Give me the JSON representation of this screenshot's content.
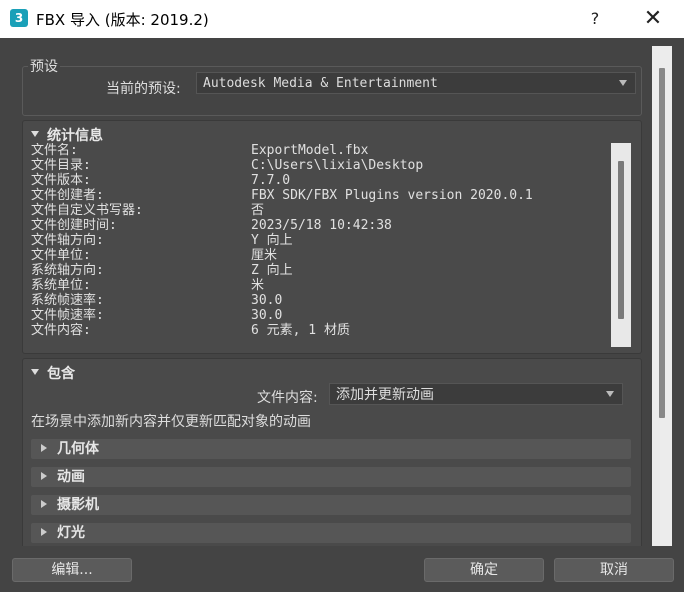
{
  "window": {
    "app_icon_letter": "3",
    "title": "FBX 导入 (版本: 2019.2)",
    "help_symbol": "?",
    "close_symbol": "✕"
  },
  "presets": {
    "legend": "预设",
    "current_label": "当前的预设:",
    "current_value": "Autodesk Media & Entertainment"
  },
  "stats": {
    "header": "统计信息",
    "rows": [
      {
        "key": "文件名:",
        "value": "ExportModel.fbx"
      },
      {
        "key": "文件目录:",
        "value": "C:\\Users\\lixia\\Desktop"
      },
      {
        "key": "文件版本:",
        "value": "7.7.0"
      },
      {
        "key": "文件创建者:",
        "value": "FBX SDK/FBX Plugins version 2020.0.1"
      },
      {
        "key": "文件自定义书写器:",
        "value": "否"
      },
      {
        "key": "文件创建时间:",
        "value": "2023/5/18  10:42:38"
      },
      {
        "key": "文件轴方向:",
        "value": "Y 向上"
      },
      {
        "key": "文件单位:",
        "value": "厘米"
      },
      {
        "key": "系统轴方向:",
        "value": "Z 向上"
      },
      {
        "key": "系统单位:",
        "value": "米"
      },
      {
        "key": "系统帧速率:",
        "value": "30.0"
      },
      {
        "key": "文件帧速率:",
        "value": "30.0"
      },
      {
        "key": "文件内容:",
        "value": "6 元素,   1 材质"
      }
    ]
  },
  "include": {
    "header": "包含",
    "content_label": "文件内容:",
    "content_value": "添加并更新动画",
    "description": "在场景中添加新内容并仅更新匹配对象的动画",
    "sections": [
      "几何体",
      "动画",
      "摄影机",
      "灯光"
    ]
  },
  "buttons": {
    "edit": "编辑...",
    "ok": "确定",
    "cancel": "取消"
  }
}
